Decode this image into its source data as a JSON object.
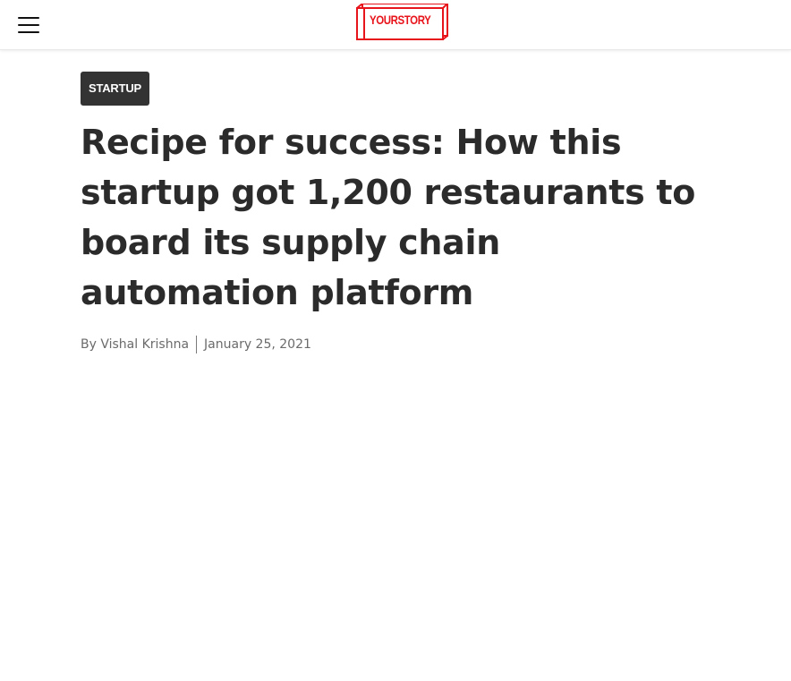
{
  "header": {
    "logo_text": "YOURSTORY",
    "brand_color": "#e8141b",
    "menu_icon": "hamburger-menu-icon"
  },
  "article": {
    "category": "STARTUP",
    "headline": "Recipe for success: How this startup got 1,200 restaurants to board its supply chain automation platform",
    "author": "By Vishal Krishna",
    "date": "January 25, 2021"
  }
}
